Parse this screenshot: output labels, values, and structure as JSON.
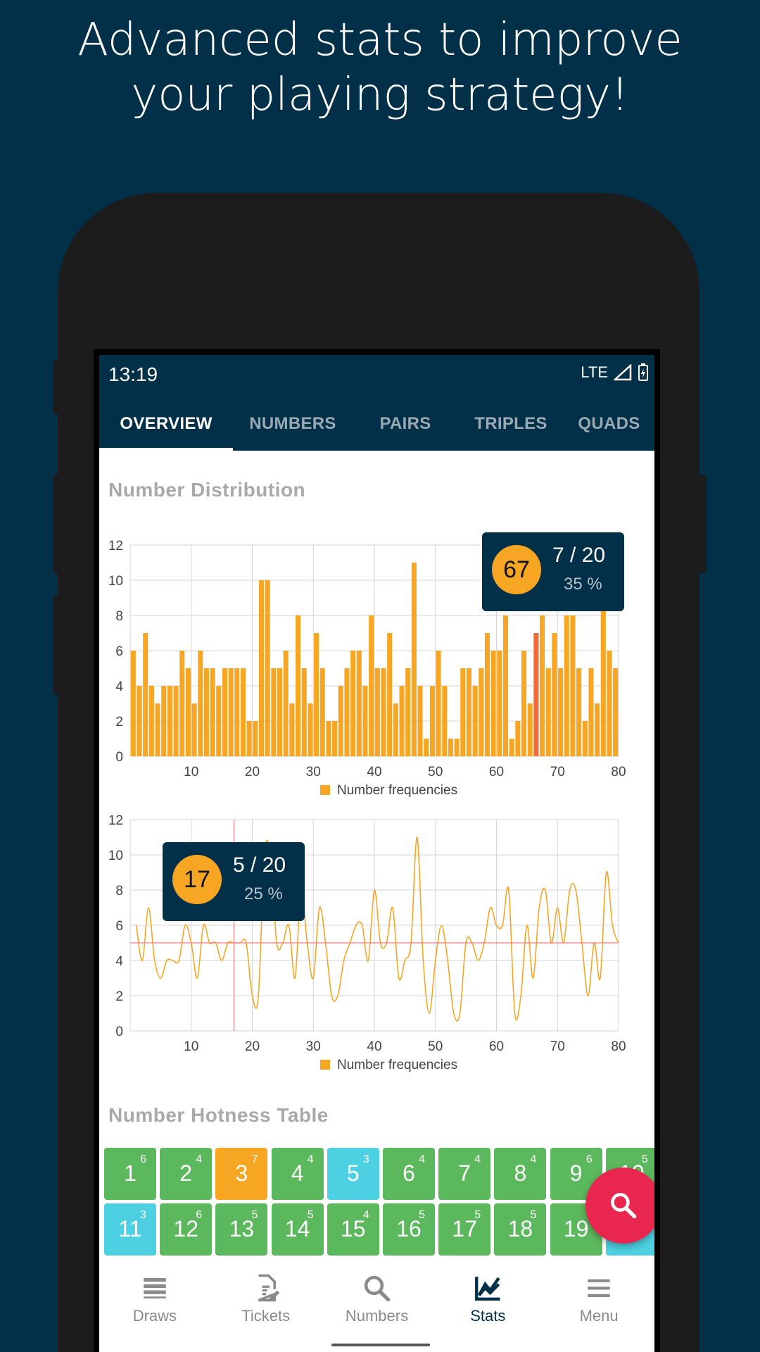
{
  "headline": {
    "line1": "Advanced stats to improve",
    "line2": "your playing strategy!"
  },
  "status_bar": {
    "time": "13:19",
    "network": "LTE"
  },
  "tabs": [
    {
      "label": "OVERVIEW",
      "active": true
    },
    {
      "label": "NUMBERS",
      "active": false
    },
    {
      "label": "PAIRS",
      "active": false
    },
    {
      "label": "TRIPLES",
      "active": false
    },
    {
      "label": "QUADS",
      "active": false
    }
  ],
  "sections": {
    "distribution_title": "Number Distribution",
    "hotness_title": "Number Hotness Table"
  },
  "colors": {
    "background": "#023049",
    "bar": "#f7a624",
    "bar_highlight": "#ee6c3c",
    "crosshair": "#f08080",
    "hot_green": "#5cb85c",
    "hot_orange": "#f7a624",
    "hot_cyan": "#4dd0e1",
    "fab": "#e8264e"
  },
  "chart_data": [
    {
      "type": "bar",
      "x": [
        1,
        2,
        3,
        4,
        5,
        6,
        7,
        8,
        9,
        10,
        11,
        12,
        13,
        14,
        15,
        16,
        17,
        18,
        19,
        20,
        21,
        22,
        23,
        24,
        25,
        26,
        27,
        28,
        29,
        30,
        31,
        32,
        33,
        34,
        35,
        36,
        37,
        38,
        39,
        40,
        41,
        42,
        43,
        44,
        45,
        46,
        47,
        48,
        49,
        50,
        51,
        52,
        53,
        54,
        55,
        56,
        57,
        58,
        59,
        60,
        61,
        62,
        63,
        64,
        65,
        66,
        67,
        68,
        69,
        70,
        71,
        72,
        73,
        74,
        75,
        76,
        77,
        78,
        79,
        80
      ],
      "values": [
        6,
        4,
        7,
        4,
        3,
        4,
        4,
        4,
        6,
        5,
        3,
        6,
        5,
        5,
        4,
        5,
        5,
        5,
        5,
        2,
        2,
        10,
        10,
        5,
        5,
        6,
        3,
        8,
        5,
        3,
        7,
        5,
        2,
        2,
        4,
        5,
        6,
        6,
        4,
        8,
        5,
        5,
        7,
        3,
        4,
        5,
        11,
        4,
        1,
        4,
        6,
        4,
        1,
        1,
        5,
        5,
        4,
        5,
        7,
        6,
        6,
        8,
        1,
        2,
        6,
        3,
        7,
        8,
        5,
        7,
        5,
        8,
        8,
        5,
        2,
        5,
        3,
        9,
        6,
        5
      ],
      "highlight_x": 67,
      "xticks": [
        10,
        20,
        30,
        40,
        50,
        60,
        70,
        80
      ],
      "yticks": [
        0,
        2,
        4,
        6,
        8,
        10,
        12
      ],
      "ylim": [
        0,
        12
      ],
      "xlim": [
        0,
        80
      ],
      "grid": true,
      "legend": "Number frequencies",
      "legend_position": "bottom",
      "tooltip": {
        "number": "67",
        "fraction": "7 / 20",
        "percent": "35 %"
      }
    },
    {
      "type": "line",
      "x": [
        1,
        2,
        3,
        4,
        5,
        6,
        7,
        8,
        9,
        10,
        11,
        12,
        13,
        14,
        15,
        16,
        17,
        18,
        19,
        20,
        21,
        22,
        23,
        24,
        25,
        26,
        27,
        28,
        29,
        30,
        31,
        32,
        33,
        34,
        35,
        36,
        37,
        38,
        39,
        40,
        41,
        42,
        43,
        44,
        45,
        46,
        47,
        48,
        49,
        50,
        51,
        52,
        53,
        54,
        55,
        56,
        57,
        58,
        59,
        60,
        61,
        62,
        63,
        64,
        65,
        66,
        67,
        68,
        69,
        70,
        71,
        72,
        73,
        74,
        75,
        76,
        77,
        78,
        79,
        80
      ],
      "values": [
        6,
        4,
        7,
        4,
        3,
        4,
        4,
        4,
        6,
        5,
        3,
        6,
        5,
        5,
        4,
        5,
        5,
        5,
        5,
        2,
        2,
        10,
        10,
        5,
        5,
        6,
        3,
        8,
        5,
        3,
        7,
        5,
        2,
        2,
        4,
        5,
        6,
        6,
        4,
        8,
        5,
        5,
        7,
        3,
        4,
        5,
        11,
        4,
        1,
        4,
        6,
        4,
        1,
        1,
        5,
        5,
        4,
        5,
        7,
        6,
        6,
        8,
        1,
        2,
        6,
        3,
        7,
        8,
        5,
        7,
        5,
        8,
        8,
        5,
        2,
        5,
        3,
        9,
        6,
        5
      ],
      "crosshair": {
        "x": 17,
        "y": 5
      },
      "xticks": [
        10,
        20,
        30,
        40,
        50,
        60,
        70,
        80
      ],
      "yticks": [
        0,
        2,
        4,
        6,
        8,
        10,
        12
      ],
      "ylim": [
        0,
        12
      ],
      "xlim": [
        0,
        80
      ],
      "grid": true,
      "legend": "Number frequencies",
      "legend_position": "bottom",
      "tooltip": {
        "number": "17",
        "fraction": "5 / 20",
        "percent": "25 %"
      }
    }
  ],
  "hotness": [
    [
      {
        "num": "1",
        "sup": "6",
        "color": "green"
      },
      {
        "num": "2",
        "sup": "4",
        "color": "green"
      },
      {
        "num": "3",
        "sup": "7",
        "color": "orange"
      },
      {
        "num": "4",
        "sup": "4",
        "color": "green"
      },
      {
        "num": "5",
        "sup": "3",
        "color": "cyan"
      },
      {
        "num": "6",
        "sup": "4",
        "color": "green"
      },
      {
        "num": "7",
        "sup": "4",
        "color": "green"
      },
      {
        "num": "8",
        "sup": "4",
        "color": "green"
      },
      {
        "num": "9",
        "sup": "6",
        "color": "green"
      },
      {
        "num": "10",
        "sup": "5",
        "color": "green"
      }
    ],
    [
      {
        "num": "11",
        "sup": "3",
        "color": "cyan"
      },
      {
        "num": "12",
        "sup": "6",
        "color": "green"
      },
      {
        "num": "13",
        "sup": "5",
        "color": "green"
      },
      {
        "num": "14",
        "sup": "5",
        "color": "green"
      },
      {
        "num": "15",
        "sup": "4",
        "color": "green"
      },
      {
        "num": "16",
        "sup": "5",
        "color": "green"
      },
      {
        "num": "17",
        "sup": "5",
        "color": "green"
      },
      {
        "num": "18",
        "sup": "5",
        "color": "green"
      },
      {
        "num": "19",
        "sup": "",
        "color": "green"
      },
      {
        "num": "",
        "sup": "",
        "color": "cyan"
      }
    ]
  ],
  "fab": {
    "icon": "search-icon"
  },
  "bottom_nav": [
    {
      "label": "Draws",
      "icon": "list-icon",
      "active": false
    },
    {
      "label": "Tickets",
      "icon": "ticket-edit-icon",
      "active": false
    },
    {
      "label": "Numbers",
      "icon": "search-icon",
      "active": false
    },
    {
      "label": "Stats",
      "icon": "chart-icon",
      "active": true
    },
    {
      "label": "Menu",
      "icon": "menu-icon",
      "active": false
    }
  ]
}
